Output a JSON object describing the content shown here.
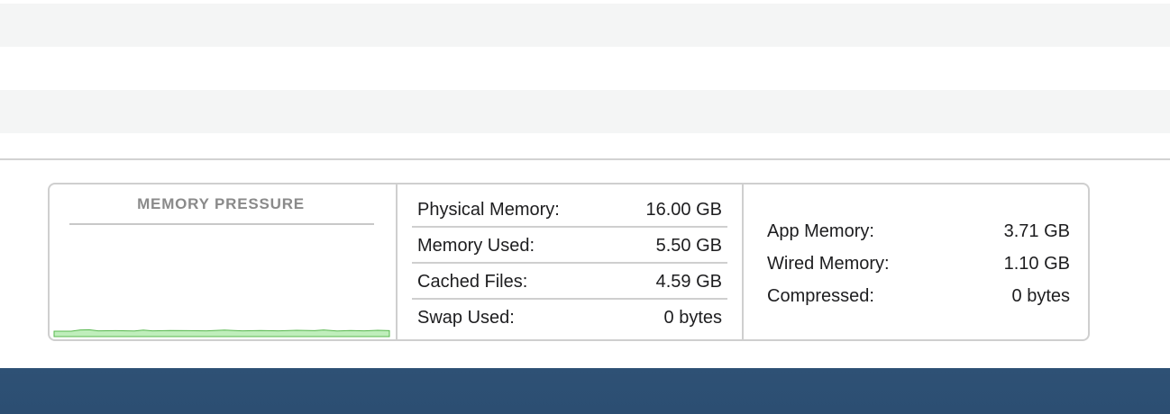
{
  "colors": {
    "stripe_gray": "#f4f5f5",
    "panel_border": "#cfcfcf",
    "pressure_green_fill": "#bfeebb",
    "pressure_green_stroke": "#58b84f",
    "footer_blue": "#2d5073"
  },
  "memory_pressure": {
    "title": "MEMORY PRESSURE",
    "level": "low"
  },
  "stats": [
    {
      "label": "Physical Memory:",
      "value": "16.00 GB"
    },
    {
      "label": "Memory Used:",
      "value": "5.50 GB"
    },
    {
      "label": "Cached Files:",
      "value": "4.59 GB"
    },
    {
      "label": "Swap Used:",
      "value": "0 bytes"
    }
  ],
  "breakdown": [
    {
      "label": "App Memory:",
      "value": "3.71 GB"
    },
    {
      "label": "Wired Memory:",
      "value": "1.10 GB"
    },
    {
      "label": "Compressed:",
      "value": "0 bytes"
    }
  ]
}
